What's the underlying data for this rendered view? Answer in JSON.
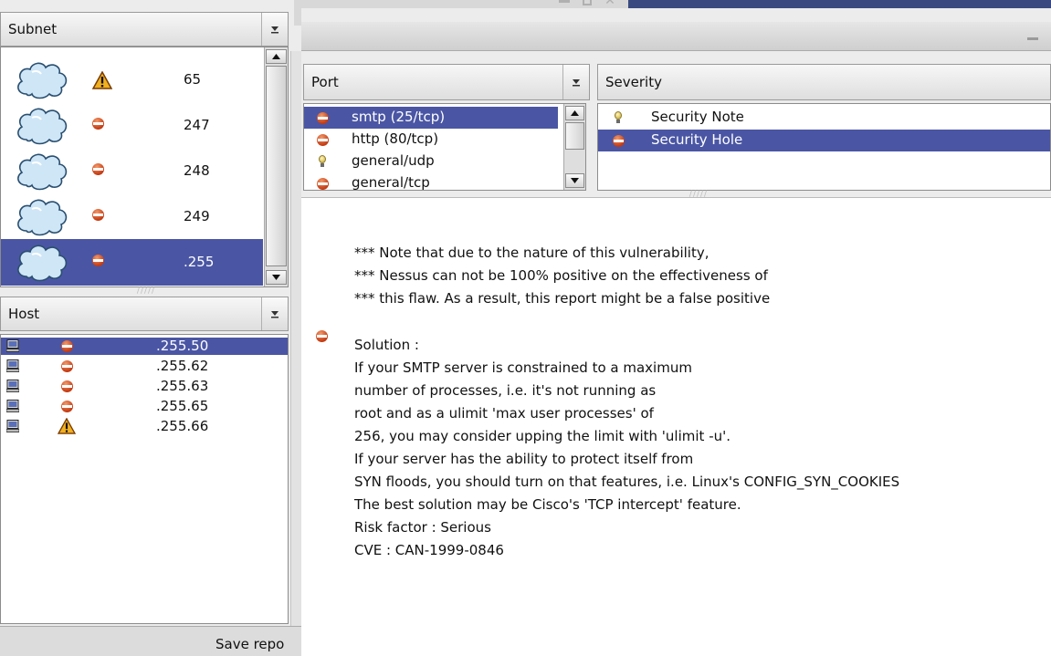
{
  "window": {
    "title_controls": [
      "minimize",
      "maximize",
      "close"
    ]
  },
  "subnet_panel": {
    "header": "Subnet",
    "items": [
      {
        "label": "65",
        "severity": "warning"
      },
      {
        "label": "247",
        "severity": "hole"
      },
      {
        "label": "248",
        "severity": "hole"
      },
      {
        "label": "249",
        "severity": "hole"
      },
      {
        "label": ".255",
        "severity": "hole",
        "selected": true
      }
    ]
  },
  "host_panel": {
    "header": "Host",
    "items": [
      {
        "label": ".255.50",
        "severity": "hole",
        "selected": true
      },
      {
        "label": ".255.62",
        "severity": "hole"
      },
      {
        "label": ".255.63",
        "severity": "hole"
      },
      {
        "label": ".255.65",
        "severity": "hole"
      },
      {
        "label": ".255.66",
        "severity": "warning"
      }
    ]
  },
  "port_panel": {
    "header": "Port",
    "items": [
      {
        "label": "smtp (25/tcp)",
        "severity": "hole",
        "selected": true
      },
      {
        "label": "http (80/tcp)",
        "severity": "hole"
      },
      {
        "label": "general/udp",
        "severity": "note"
      },
      {
        "label": "general/tcp",
        "severity": "hole"
      }
    ]
  },
  "severity_panel": {
    "header": "Severity",
    "items": [
      {
        "label": "Security Note",
        "severity": "note"
      },
      {
        "label": "Security Hole",
        "severity": "hole",
        "selected": true
      }
    ]
  },
  "report": {
    "note_lines": [
      "*** Note that due to the nature of this vulnerability,",
      "*** Nessus can not be 100% positive on the effectiveness of",
      "*** this flaw. As a result, this report might be a false positive"
    ],
    "solution_lines": [
      "Solution :",
      "If your SMTP server is constrained to a maximum",
      "number of processes, i.e. it's not running as",
      "root and as a ulimit 'max user processes' of",
      "256, you may consider upping the limit with 'ulimit -u'.",
      "",
      "If your server has the ability to protect itself from",
      "SYN floods, you should turn on that features, i.e. Linux's CONFIG_SYN_COOKIES",
      "",
      "The best solution may be Cisco's 'TCP intercept' feature.",
      "",
      "",
      "Risk factor : Serious",
      "CVE : CAN-1999-0846"
    ]
  },
  "footer": {
    "save_report_label": "Save repo"
  },
  "colors": {
    "selection": "#4a56a4",
    "titlebar": "#3a4a80"
  }
}
